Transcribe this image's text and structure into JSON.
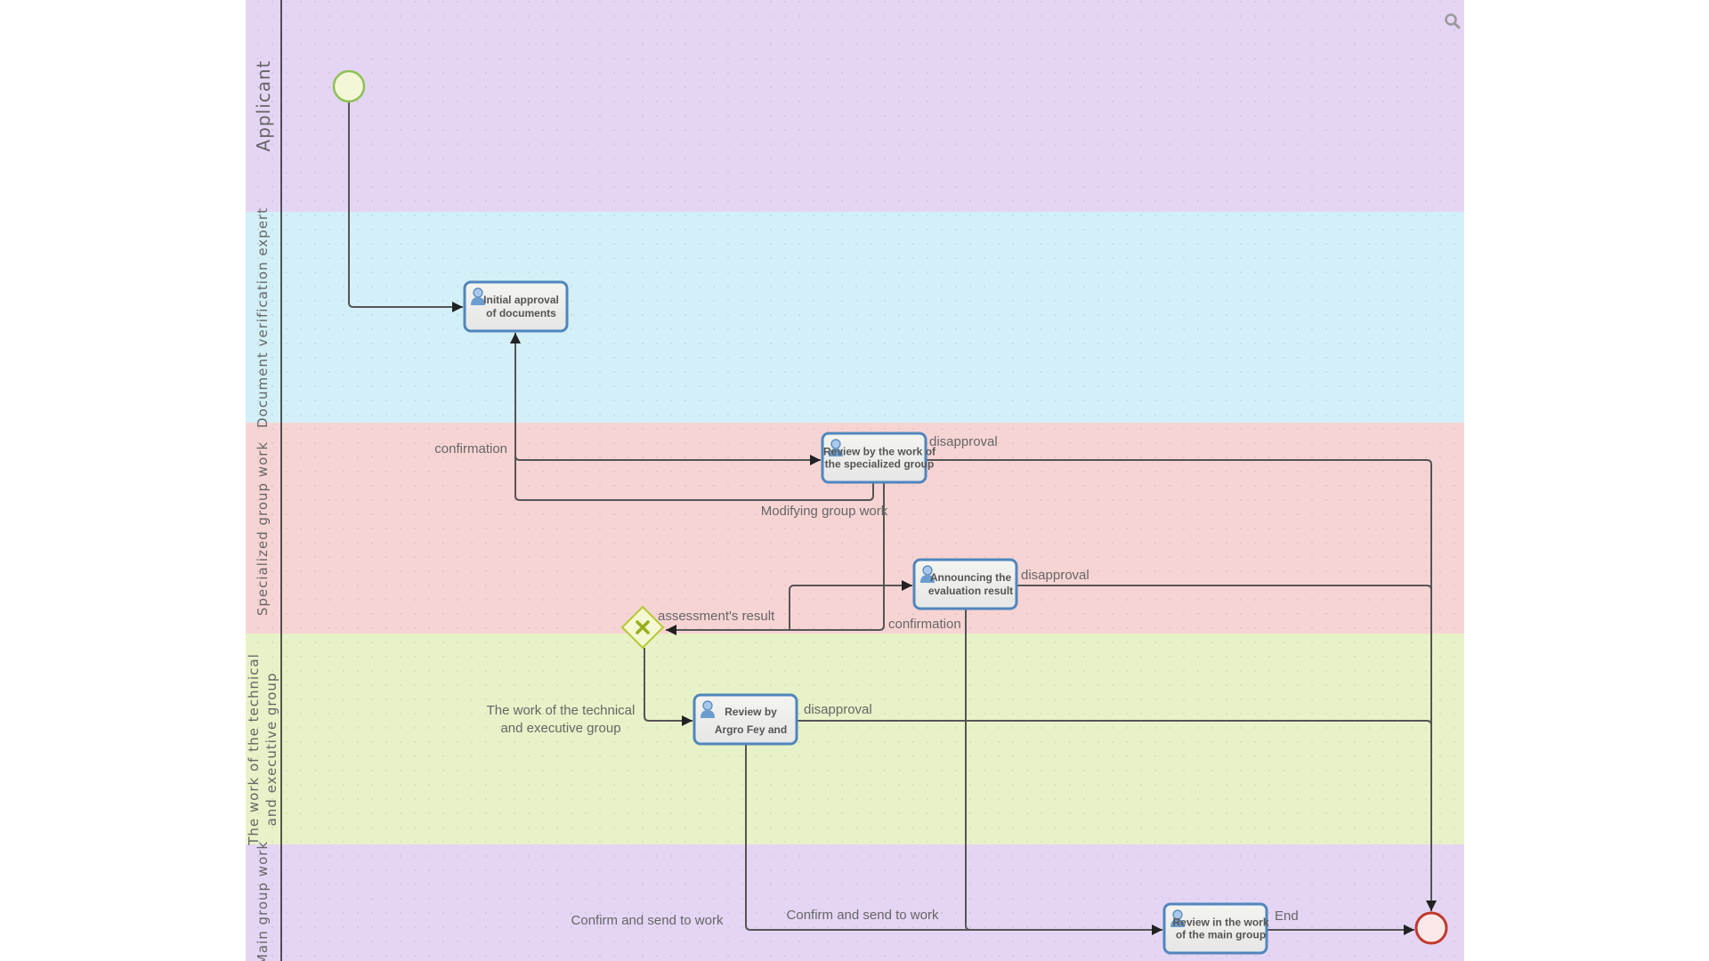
{
  "colors": {
    "lane_purple": "#e5d5f4",
    "lane_blue": "#d3eff7",
    "lane_pink": "#f7d4d4",
    "lane_green": "#e8f2c8",
    "task_border": "#4f86bd",
    "start_event": "#8cc152",
    "end_event": "#c0392b",
    "gateway": "#b5c832"
  },
  "lanes": [
    {
      "label": "Applicant"
    },
    {
      "label": "Document verification expert"
    },
    {
      "label": "Specialized group work"
    },
    {
      "label_line1": "The work of the technical",
      "label_line2": "and executive group"
    },
    {
      "label": "Main group work"
    }
  ],
  "tasks": [
    {
      "line1": "Initial approval",
      "line2": "of documents",
      "icon": "user-icon"
    },
    {
      "line1": "Review by the work of",
      "line2": "the specialized group",
      "icon": "user-icon"
    },
    {
      "line1": "Announcing the",
      "line2": "evaluation result",
      "icon": "user-icon"
    },
    {
      "line1": "Review by",
      "line2": "Argro Fey and",
      "icon": "user-icon"
    },
    {
      "line1": "Review in the work",
      "line2": "of the main group",
      "icon": "user-icon"
    }
  ],
  "gateway": {
    "type": "exclusive",
    "icon": "x-icon"
  },
  "edge_labels": {
    "confirmation_1": "confirmation",
    "disapproval_1": "disapproval",
    "modifying": "Modifying group work",
    "disapproval_2": "disapproval",
    "assessment": "assessment's result",
    "confirmation_2": "confirmation",
    "technical_line1": "The work of the technical",
    "technical_line2": "and executive group",
    "disapproval_3": "disapproval",
    "confirm_send_1": "Confirm and send to work",
    "confirm_send_2": "Confirm and send to work",
    "end": "End"
  },
  "toolbar": {
    "search_icon": "magnifier-icon"
  }
}
